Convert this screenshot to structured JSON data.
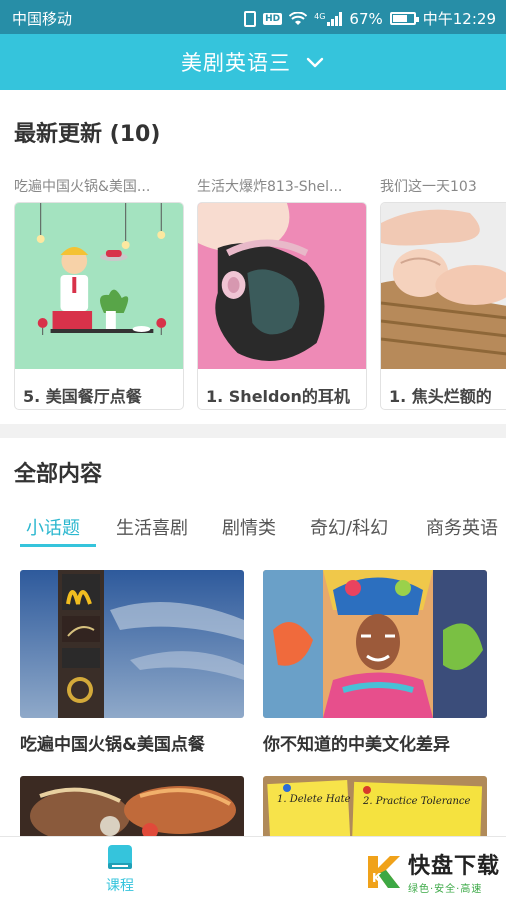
{
  "status": {
    "carrier": "中国移动",
    "network": "4G",
    "battery": "67%",
    "time": "中午12:29"
  },
  "header": {
    "title": "美剧英语三"
  },
  "latest": {
    "title": "最新更新 (10)",
    "cards": [
      {
        "caption": "吃遍中国火锅&美国...",
        "label": "5. 美国餐厅点餐"
      },
      {
        "caption": "生活大爆炸813-Shel...",
        "label": "1. Sheldon的耳机"
      },
      {
        "caption": "我们这一天103",
        "label": "1. 焦头烂额的"
      }
    ]
  },
  "all": {
    "title": "全部内容",
    "tabs": [
      "小话题",
      "生活喜剧",
      "剧情类",
      "奇幻/科幻",
      "商务英语"
    ],
    "items": [
      {
        "title": "吃遍中国火锅&美国点餐"
      },
      {
        "title": "你不知道的中美文化差异"
      },
      {
        "title": ""
      },
      {
        "title": ""
      }
    ],
    "note_lines": [
      "1. Delete Hate",
      "2. Practice Tolerance"
    ]
  },
  "bottom_nav": {
    "course_label": "课程"
  },
  "watermark": {
    "brand": "快盘下载",
    "tagline": "绿色·安全·高速",
    "letter": "K"
  },
  "colors": {
    "primary": "#35c4dc",
    "statusbar": "#278ea7"
  }
}
